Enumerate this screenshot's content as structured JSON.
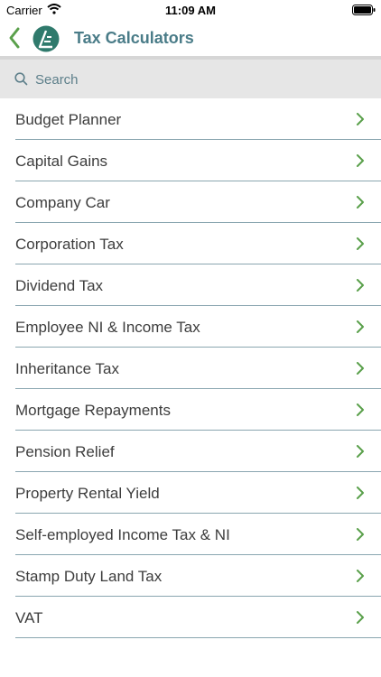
{
  "status": {
    "carrier": "Carrier",
    "time": "11:09 AM"
  },
  "nav": {
    "title": "Tax Calculators"
  },
  "search": {
    "placeholder": "Search"
  },
  "items": [
    {
      "label": "Budget Planner"
    },
    {
      "label": "Capital Gains"
    },
    {
      "label": "Company Car"
    },
    {
      "label": "Corporation Tax"
    },
    {
      "label": "Dividend Tax"
    },
    {
      "label": "Employee NI & Income Tax"
    },
    {
      "label": "Inheritance Tax"
    },
    {
      "label": "Mortgage Repayments"
    },
    {
      "label": "Pension Relief"
    },
    {
      "label": "Property Rental Yield"
    },
    {
      "label": "Self-employed Income Tax & NI"
    },
    {
      "label": "Stamp Duty Land Tax"
    },
    {
      "label": "VAT"
    }
  ],
  "colors": {
    "accent": "#4a7c88",
    "chevron": "#5aa04b",
    "divider": "#8aa6b0"
  }
}
